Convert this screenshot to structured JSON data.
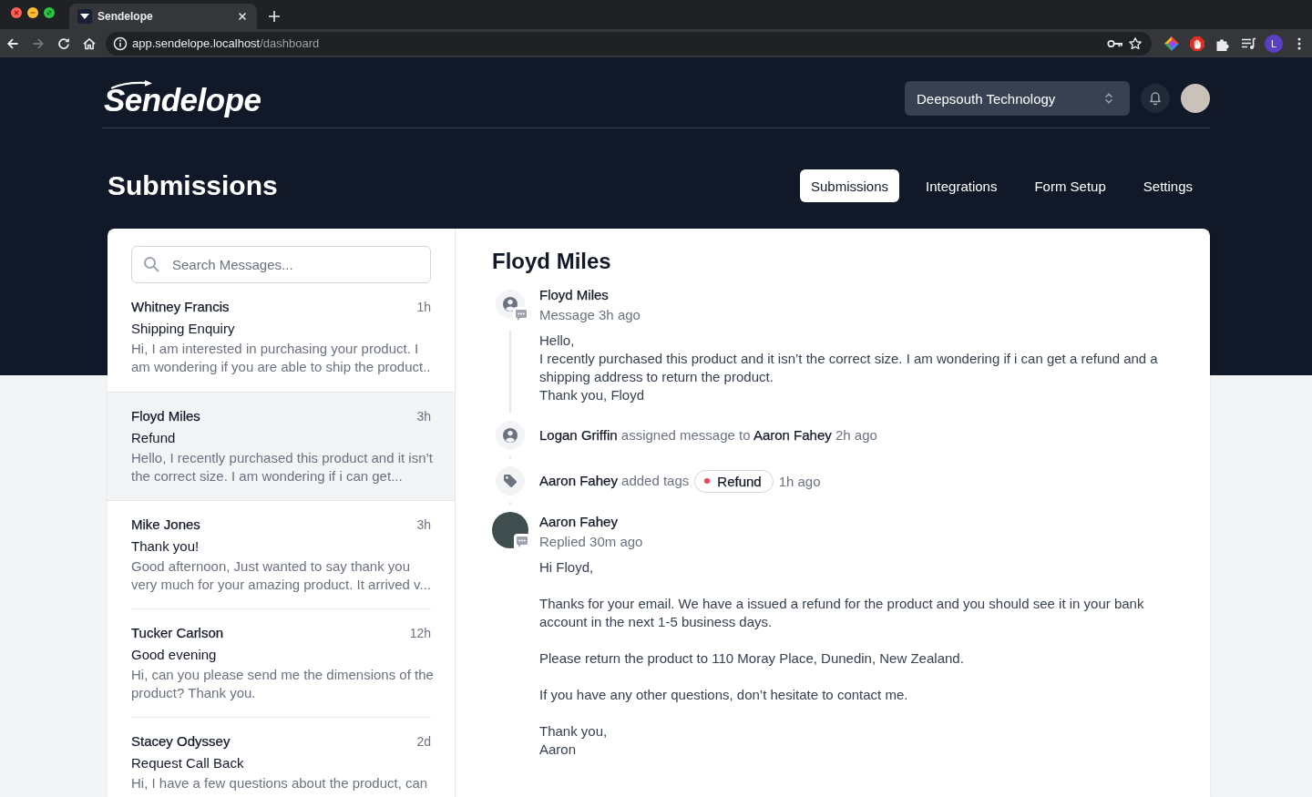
{
  "browser": {
    "tab": {
      "title": "Sendelope"
    },
    "nav_buttons": [
      {
        "kind": "back",
        "disabled": false
      },
      {
        "kind": "forward",
        "disabled": true
      },
      {
        "kind": "reload",
        "disabled": false
      },
      {
        "kind": "home",
        "disabled": false
      }
    ],
    "address": {
      "host": "app.sendelope.localhost",
      "path": "/dashboard"
    },
    "profile": {
      "initial": "L"
    }
  },
  "header": {
    "logo": "Sendelope",
    "workspace": {
      "value": "Deepsouth Technology"
    }
  },
  "page": {
    "title": "Submissions",
    "tabs": [
      {
        "label": "Submissions",
        "selected": true
      },
      {
        "label": "Integrations",
        "selected": false
      },
      {
        "label": "Form Setup",
        "selected": false
      },
      {
        "label": "Settings",
        "selected": false
      }
    ]
  },
  "inbox": {
    "search": {
      "placeholder": "Search Messages..."
    },
    "messages": [
      {
        "name": "Whitney Francis",
        "time": "1h",
        "subject": "Shipping Enquiry",
        "preview": "Hi, I am interested in purchasing your product. I am wondering if you are able to ship the product..",
        "selected": false
      },
      {
        "name": "Floyd Miles",
        "time": "3h",
        "subject": "Refund",
        "preview": "Hello, I recently purchased this product and it isn’t the correct size. I am wondering if i can get...",
        "selected": true
      },
      {
        "name": "Mike Jones",
        "time": "3h",
        "subject": "Thank you!",
        "preview": "Good afternoon, Just wanted to say thank you very much for your amazing product. It arrived v...",
        "selected": false
      },
      {
        "name": "Tucker Carlson",
        "time": "12h",
        "subject": "Good evening",
        "preview": "Hi, can you please send me the dimensions of the product? Thank you.",
        "selected": false
      },
      {
        "name": "Stacey Odyssey",
        "time": "2d",
        "subject": "Request Call Back",
        "preview": "Hi, I have a few questions about the product, can",
        "selected": false
      }
    ]
  },
  "conversation": {
    "title": "Floyd Miles",
    "timeline": [
      {
        "kind": "message",
        "author": "Floyd Miles",
        "meta": "Message 3h ago",
        "body": [
          "Hello,\nI recently purchased this product and it isn’t the correct size. I am wondering if i can get a refund and a shipping address to return the product.\nThank you, Floyd"
        ]
      },
      {
        "kind": "assignment",
        "text": "**Logan Griffin** assigned message to **Aaron Fahey** 2h ago"
      },
      {
        "kind": "tags",
        "text": "**Aaron Fahey** added tags",
        "tags": [
          {
            "label": "Refund",
            "color": "#f43f5e"
          }
        ],
        "time": "1h ago"
      },
      {
        "kind": "reply",
        "author": "Aaron Fahey",
        "meta": "Replied 30m ago",
        "body": [
          "Hi Floyd,",
          "Thanks for your email. We have a issued a refund for the product and you should see it in your bank account in the next 1-5 business days.",
          "Please return the product to 110 Moray Place, Dunedin, New Zealand.",
          "If you have any other questions, don’t hesitate to contact me.",
          "Thank you,\nAaron"
        ]
      }
    ]
  }
}
